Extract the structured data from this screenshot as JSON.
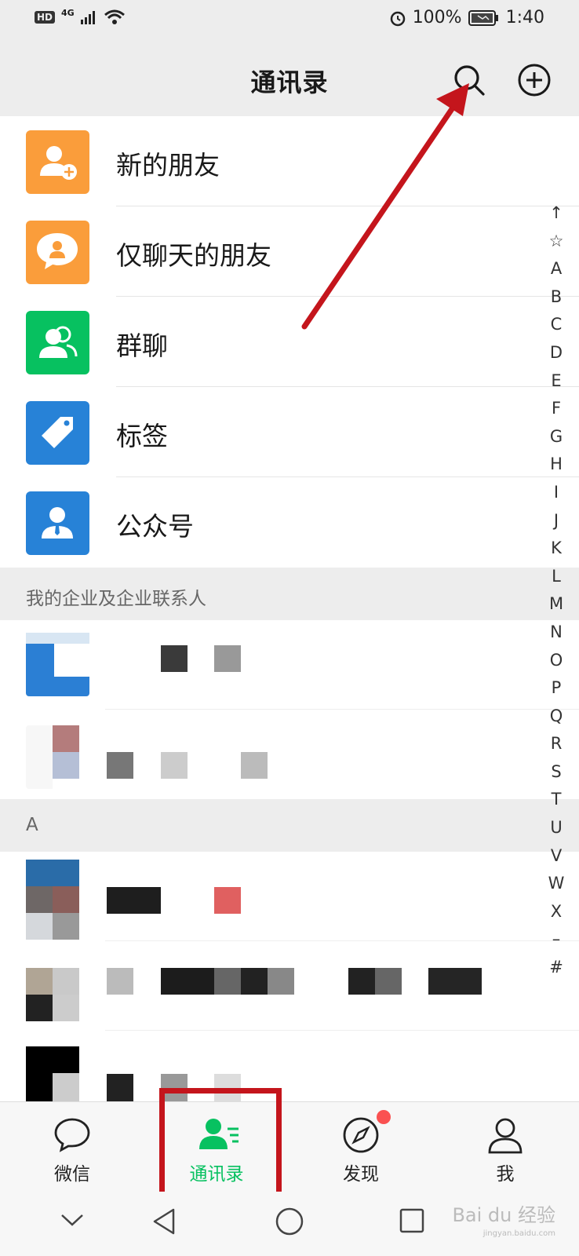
{
  "status": {
    "hd": "HD",
    "network": "4G",
    "battery": "100%",
    "time": "1:40"
  },
  "header": {
    "title": "通讯录",
    "search_icon": "search-icon",
    "add_icon": "plus-circle-icon"
  },
  "menu": [
    {
      "label": "新的朋友",
      "icon": "add-friend-icon",
      "color": "#fa9d3b"
    },
    {
      "label": "仅聊天的朋友",
      "icon": "chat-only-friend-icon",
      "color": "#fa9d3b"
    },
    {
      "label": "群聊",
      "icon": "group-chat-icon",
      "color": "#07c160"
    },
    {
      "label": "标签",
      "icon": "tag-icon",
      "color": "#2782d7"
    },
    {
      "label": "公众号",
      "icon": "official-account-icon",
      "color": "#2782d7"
    }
  ],
  "enterprise_section": {
    "title": "我的企业及企业联系人"
  },
  "letter_section": {
    "title": "A"
  },
  "index": [
    "↑",
    "☆",
    "A",
    "B",
    "C",
    "D",
    "E",
    "F",
    "G",
    "H",
    "I",
    "J",
    "K",
    "L",
    "M",
    "N",
    "O",
    "P",
    "Q",
    "R",
    "S",
    "T",
    "U",
    "V",
    "W",
    "X",
    "–",
    "#"
  ],
  "tabs": [
    {
      "label": "微信",
      "icon": "chat-bubble-icon"
    },
    {
      "label": "通讯录",
      "icon": "contacts-icon",
      "active": true
    },
    {
      "label": "发现",
      "icon": "compass-icon",
      "badge": true
    },
    {
      "label": "我",
      "icon": "person-icon"
    }
  ],
  "watermark": {
    "text": "Bai du 经验",
    "sub": "jingyan.baidu.com"
  },
  "colors": {
    "accent": "#07c160",
    "annotation": "#c4151c"
  }
}
